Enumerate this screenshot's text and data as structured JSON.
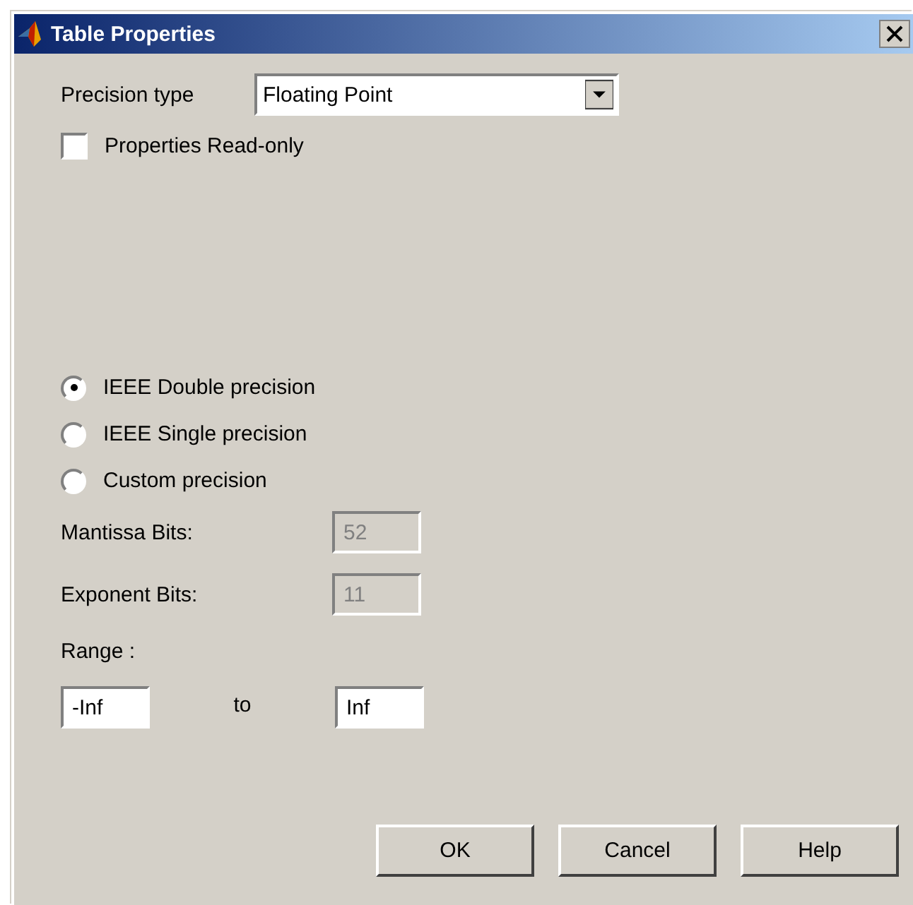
{
  "window": {
    "title": "Table Properties"
  },
  "precision_type": {
    "label": "Precision type",
    "value": "Floating Point"
  },
  "read_only": {
    "label": "Properties Read-only",
    "checked": false
  },
  "options": [
    {
      "label": "IEEE Double precision",
      "selected": true
    },
    {
      "label": "IEEE Single precision",
      "selected": false
    },
    {
      "label": "Custom precision",
      "selected": false
    }
  ],
  "fields": [
    {
      "label": "Mantissa Bits:",
      "value": "52",
      "disabled": true
    },
    {
      "label": "Exponent Bits:",
      "value": "11",
      "disabled": true
    }
  ],
  "range": {
    "label": "Range :",
    "from": "-Inf",
    "separator": "to",
    "to": "Inf"
  },
  "buttons": [
    "OK",
    "Cancel",
    "Help"
  ]
}
